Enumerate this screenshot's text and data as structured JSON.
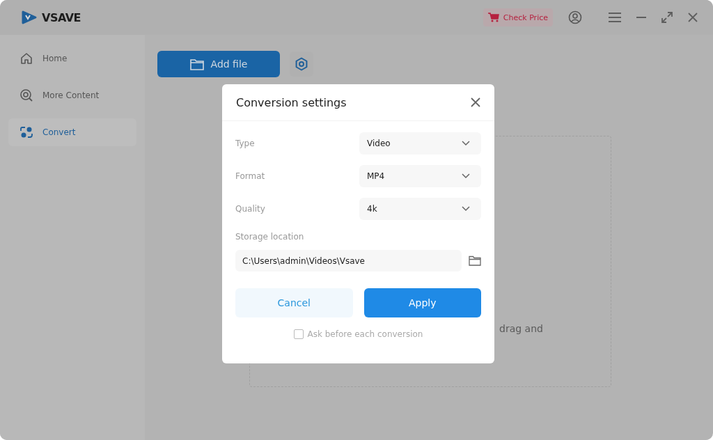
{
  "app": {
    "name": "VSAVE"
  },
  "header": {
    "check_price": "Check Price"
  },
  "sidebar": {
    "items": [
      {
        "label": "Home",
        "selected": false
      },
      {
        "label": "More Content",
        "selected": false
      },
      {
        "label": "Convert",
        "selected": true
      }
    ]
  },
  "toolbar": {
    "add_file": "Add file"
  },
  "drop_zone": {
    "text": "drag and"
  },
  "dialog": {
    "title": "Conversion settings",
    "fields": [
      {
        "label": "Type",
        "value": "Video"
      },
      {
        "label": "Format",
        "value": "MP4"
      },
      {
        "label": "Quality",
        "value": "4k"
      }
    ],
    "storage": {
      "label": "Storage location",
      "path": "C:\\Users\\admin\\Videos\\Vsave"
    },
    "cancel": "Cancel",
    "apply": "Apply",
    "ask": {
      "label": "Ask before each conversion",
      "checked": false
    }
  }
}
